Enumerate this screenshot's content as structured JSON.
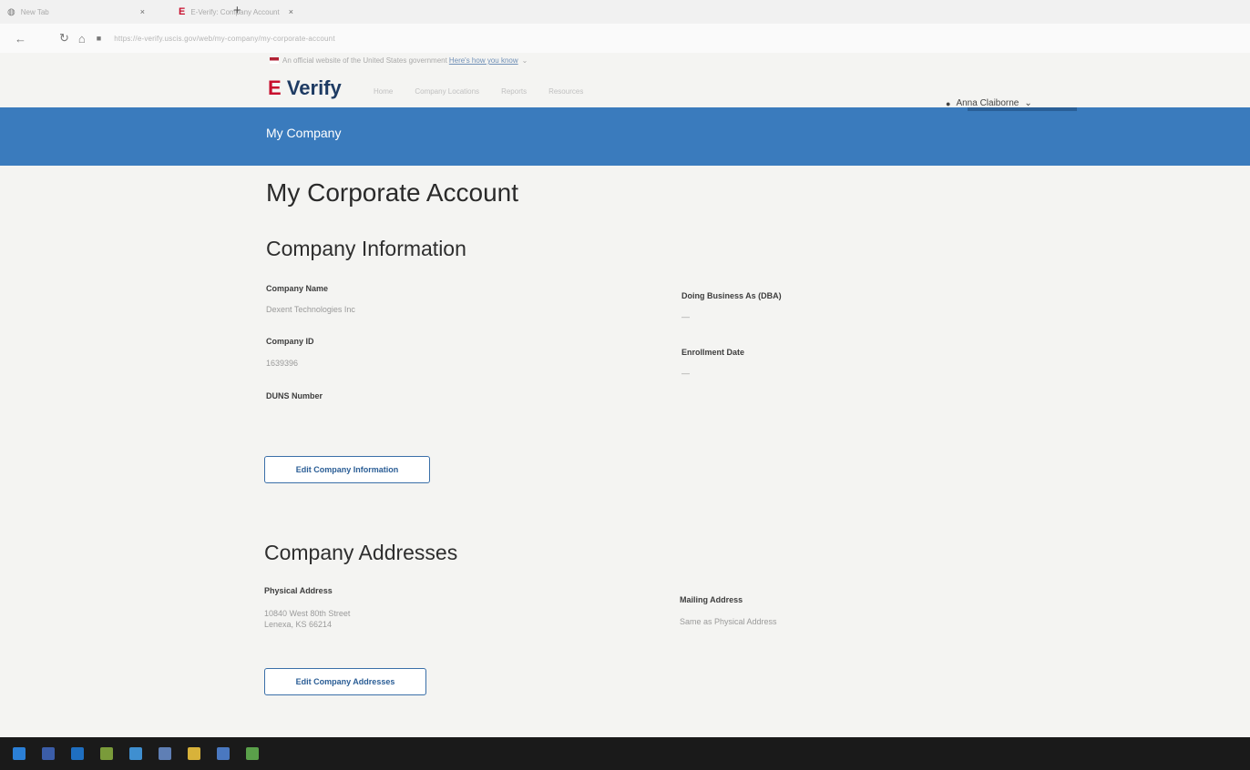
{
  "browser": {
    "tabs": [
      {
        "label": "New Tab"
      },
      {
        "label": "E-Verify: Company Account"
      }
    ],
    "new_tab_symbol": "+",
    "close_symbol": "×",
    "url": "https://e-verify.uscis.gov/web/my-company/my-corporate-account"
  },
  "gov_banner": {
    "text": "An official website of the United States government",
    "link": "Here's how you know"
  },
  "header": {
    "logo_prefix": "E",
    "logo_text": "Verify",
    "nav": [
      "Home",
      "Company Locations",
      "Reports",
      "Resources"
    ],
    "user_name": "Anna Claiborne"
  },
  "bluebar": {
    "title": "My Company"
  },
  "page": {
    "title": "My Corporate Account"
  },
  "company_info": {
    "heading": "Company Information",
    "company_name_label": "Company Name",
    "company_name": "Dexent Technologies Inc",
    "company_id_label": "Company ID",
    "company_id": "1639396",
    "duns_label": "DUNS Number",
    "dba_label": "Doing Business As (DBA)",
    "dba_value": "—",
    "enrollment_label": "Enrollment Date",
    "enrollment_value": "—",
    "edit_button": "Edit Company Information"
  },
  "addresses": {
    "heading": "Company Addresses",
    "physical_label": "Physical Address",
    "physical_line1": "10840 West 80th Street",
    "physical_line2": "Lenexa, KS 66214",
    "mailing_label": "Mailing Address",
    "mailing_value": "Same as Physical Address",
    "edit_button": "Edit Company Addresses"
  },
  "colors": {
    "brand_blue": "#3a7bbd",
    "logo_red": "#c8102e",
    "logo_navy": "#1e3b63",
    "button_blue": "#2a5d95"
  },
  "taskbar_icons": [
    {
      "name": "windows",
      "color": "#2b7fd6"
    },
    {
      "name": "app-a",
      "color": "#3b5da8"
    },
    {
      "name": "outlook",
      "color": "#1f6fc0"
    },
    {
      "name": "photos",
      "color": "#7a9b3a"
    },
    {
      "name": "app-b",
      "color": "#3f8fd0"
    },
    {
      "name": "app-c",
      "color": "#5f7fb5"
    },
    {
      "name": "files",
      "color": "#d8b23a"
    },
    {
      "name": "app-d",
      "color": "#4a78c0"
    },
    {
      "name": "chrome",
      "color": "#5aa04a"
    }
  ]
}
